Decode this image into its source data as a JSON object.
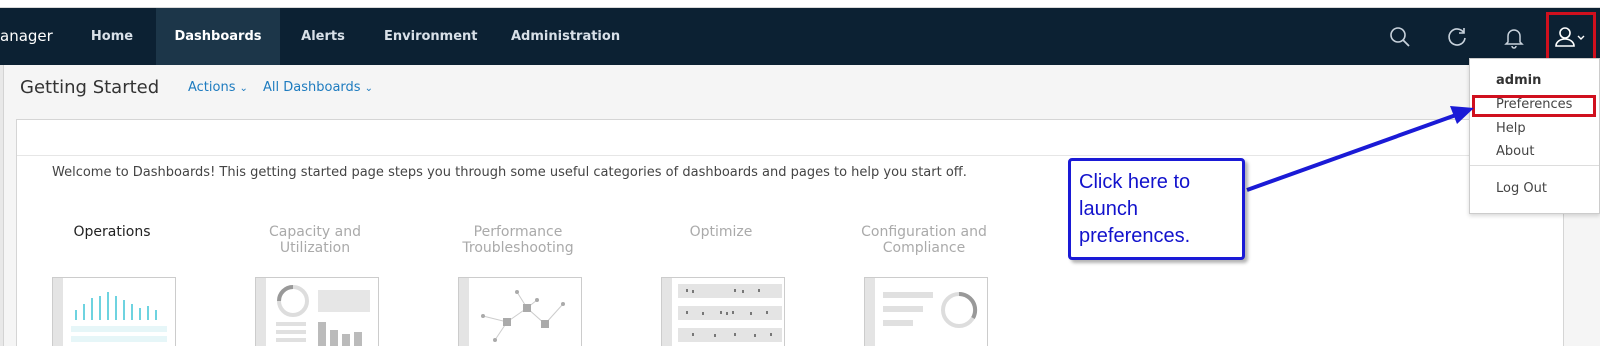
{
  "nav": {
    "brand": "anager",
    "tabs": [
      {
        "label": "Home"
      },
      {
        "label": "Dashboards"
      },
      {
        "label": "Alerts"
      },
      {
        "label": "Environment"
      },
      {
        "label": "Administration"
      }
    ],
    "active_tab": "Dashboards",
    "icons": [
      "search-icon",
      "refresh-icon",
      "bell-icon",
      "user-icon"
    ]
  },
  "header": {
    "title": "Getting Started",
    "actions_label": "Actions",
    "all_dashboards_label": "All Dashboards"
  },
  "card": {
    "welcome": "Welcome to Dashboards! This getting started page steps you through some useful categories of dashboards and pages to help you start off.",
    "categories": [
      {
        "label": "Operations"
      },
      {
        "label": "Capacity and Utilization"
      },
      {
        "label": "Performance Troubleshooting"
      },
      {
        "label": "Optimize"
      },
      {
        "label": "Configuration and Compliance"
      }
    ]
  },
  "user_menu": {
    "username": "admin",
    "items": [
      "Preferences",
      "Help",
      "About",
      "Log Out"
    ]
  },
  "annotation": {
    "callout_text": "Click here to launch preferences."
  },
  "colors": {
    "nav_bg": "#0c2133",
    "link": "#1d7bbf",
    "highlight": "#d0101e",
    "callout": "#1a1ad6"
  }
}
